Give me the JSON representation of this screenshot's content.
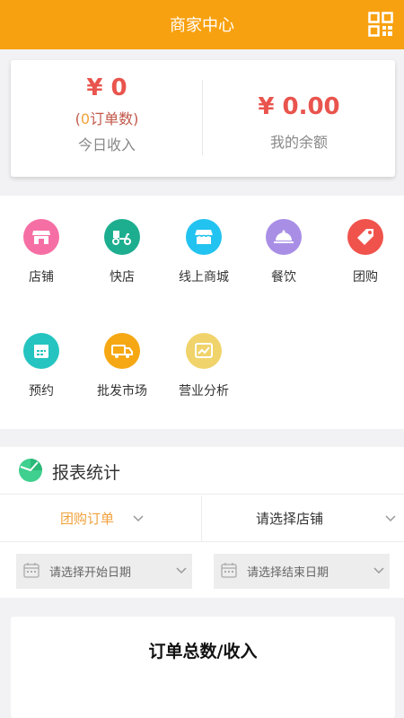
{
  "header": {
    "title": "商家中心",
    "qr_icon": "qr-code-icon"
  },
  "summary": {
    "today_amount": "¥ 0",
    "order_count_open": "(",
    "order_count_value": "0",
    "order_count_suffix": "订单数)",
    "today_label": "今日收入",
    "balance_amount": "¥ 0.00",
    "balance_label": "我的余额"
  },
  "grid": {
    "items": [
      {
        "label": "店铺",
        "icon": "store-icon",
        "color": "#f56fa4"
      },
      {
        "label": "快店",
        "icon": "delivery-bike-icon",
        "color": "#1dae8f"
      },
      {
        "label": "线上商城",
        "icon": "online-shop-icon",
        "color": "#22c3f0"
      },
      {
        "label": "餐饮",
        "icon": "dish-cloche-icon",
        "color": "#a98ee6"
      },
      {
        "label": "团购",
        "icon": "tag-icon",
        "color": "#f0534c"
      },
      {
        "label": "预约",
        "icon": "calendar-icon",
        "color": "#25c4c0"
      },
      {
        "label": "批发市场",
        "icon": "truck-icon",
        "color": "#f5a814"
      },
      {
        "label": "营业分析",
        "icon": "analytics-chart-icon",
        "color": "#f0d36a"
      }
    ]
  },
  "report": {
    "title": "报表统计",
    "filter_type": "团购订单",
    "filter_store": "请选择店铺",
    "start_date_placeholder": "请选择开始日期",
    "end_date_placeholder": "请选择结束日期"
  },
  "chart_card": {
    "title": "订单总数/收入"
  },
  "colors": {
    "brand": "#f8a110",
    "money": "#e9544d",
    "accent": "#f2a23c"
  }
}
